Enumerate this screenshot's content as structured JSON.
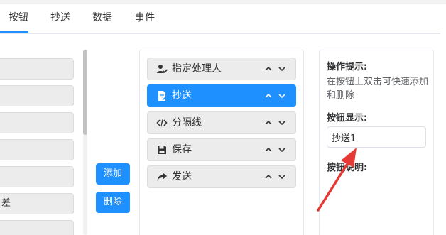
{
  "tabs": [
    {
      "label": "按钮",
      "active": true
    },
    {
      "label": "抄送",
      "active": false
    },
    {
      "label": "数据",
      "active": false
    },
    {
      "label": "事件",
      "active": false
    }
  ],
  "left_list": {
    "items": [
      "",
      "",
      "",
      "",
      "",
      "差",
      ""
    ]
  },
  "buttons": {
    "add_label": "添加",
    "delete_label": "删除"
  },
  "mid_list": {
    "items": [
      {
        "label": "指定处理人",
        "icon": "user-check-icon",
        "selected": false
      },
      {
        "label": "抄送",
        "icon": "document-edit-icon",
        "selected": true
      },
      {
        "label": "分隔线",
        "icon": "code-icon",
        "selected": false
      },
      {
        "label": "保存",
        "icon": "save-icon",
        "selected": false
      },
      {
        "label": "发送",
        "icon": "share-arrow-icon",
        "selected": false
      }
    ]
  },
  "right_panel": {
    "hint_title": "操作提示:",
    "hint_text": "在按钮上双击可快速添加和删除",
    "display_title": "按钮显示:",
    "display_value": "抄送1",
    "desc_title": "按钮说明:"
  },
  "colors": {
    "accent": "#1e90ff",
    "arrow": "#e53935"
  }
}
